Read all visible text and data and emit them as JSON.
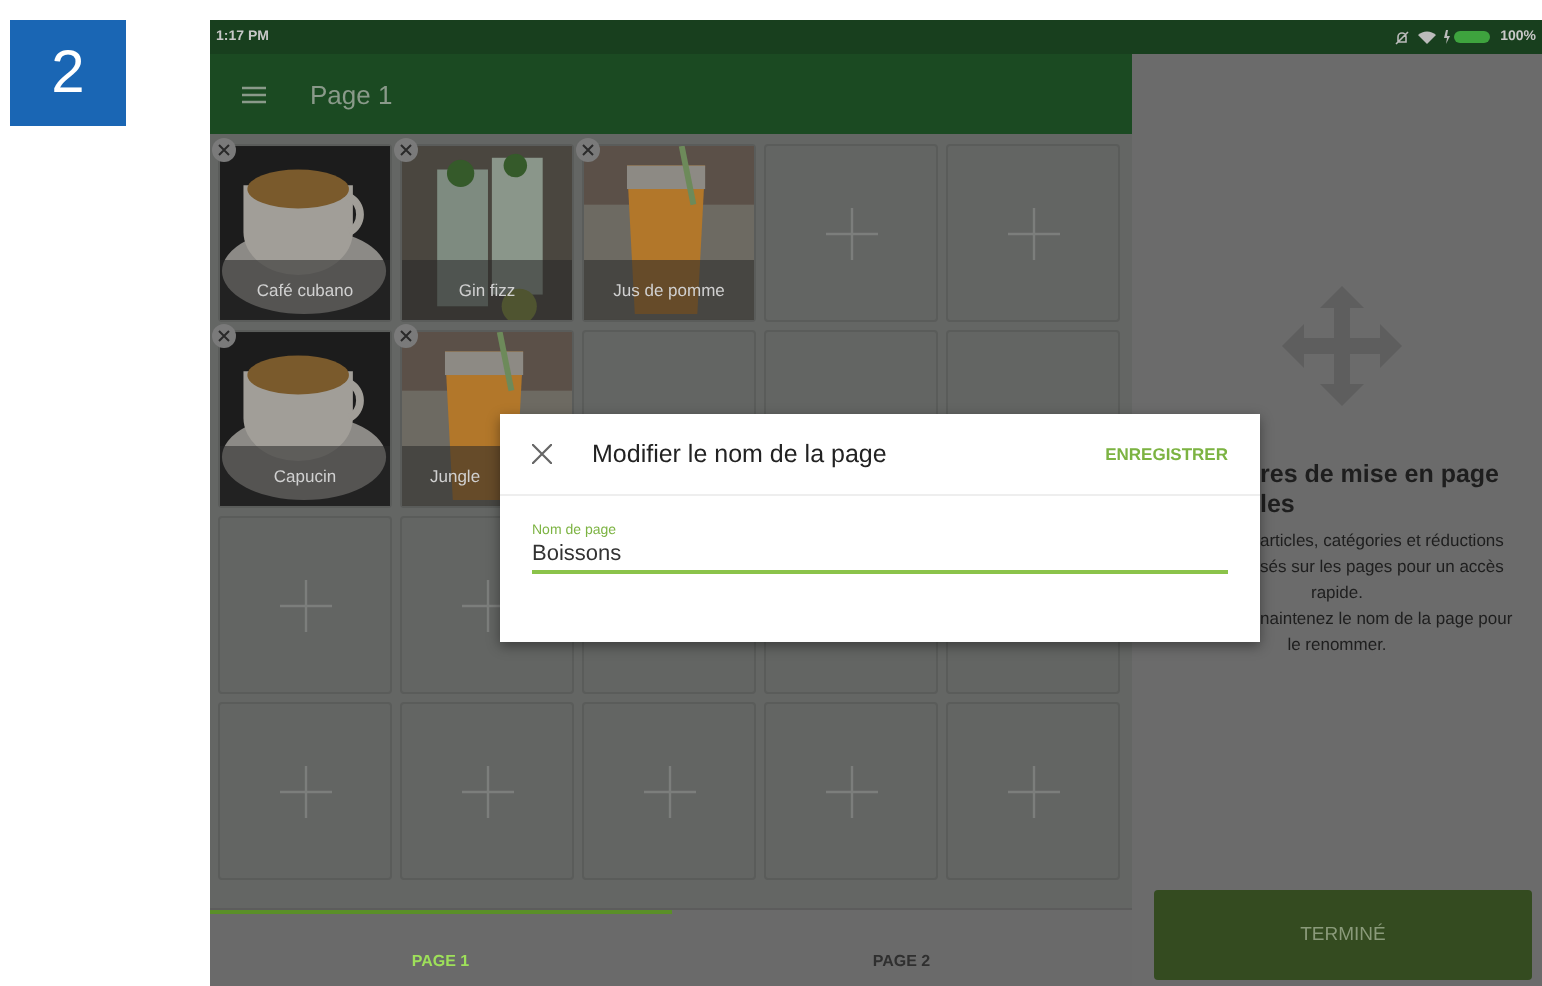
{
  "step_badge": "2",
  "status_bar": {
    "time": "1:17 PM",
    "battery": "100%"
  },
  "header": {
    "title": "Page 1"
  },
  "tiles": [
    {
      "kind": "item",
      "label": "Café cubano",
      "truncated": false
    },
    {
      "kind": "item",
      "label": "Gin fizz",
      "truncated": false
    },
    {
      "kind": "item",
      "label": "Jus de pomme",
      "truncated": false
    },
    {
      "kind": "empty"
    },
    {
      "kind": "empty"
    },
    {
      "kind": "item",
      "label": "Capucin",
      "truncated": false
    },
    {
      "kind": "item",
      "label": "Jungle",
      "truncated": true
    },
    {
      "kind": "covered"
    },
    {
      "kind": "covered"
    },
    {
      "kind": "covered"
    },
    {
      "kind": "empty"
    },
    {
      "kind": "empty"
    },
    {
      "kind": "covered"
    },
    {
      "kind": "covered"
    },
    {
      "kind": "covered"
    },
    {
      "kind": "empty"
    },
    {
      "kind": "empty"
    },
    {
      "kind": "empty"
    },
    {
      "kind": "empty"
    },
    {
      "kind": "empty"
    }
  ],
  "tabs": [
    {
      "label": "PAGE 1",
      "selected": true
    },
    {
      "label": "PAGE 2",
      "selected": false
    }
  ],
  "side_panel": {
    "title_lines": [
      "res de mise en page",
      "les"
    ],
    "body_lines": [
      {
        "kind": "cut",
        "text": "articles, catégories et réductions"
      },
      {
        "kind": "cut",
        "text": "sés sur les pages pour un accès"
      },
      {
        "kind": "full",
        "text": "rapide."
      },
      {
        "kind": "cut",
        "text": "naintenez le nom de la page pour"
      },
      {
        "kind": "full",
        "text": "le renommer."
      }
    ],
    "done_button": "TERMINÉ"
  },
  "dialog": {
    "title": "Modifier le nom de la page",
    "save": "ENREGISTRER",
    "field_label": "Nom de page",
    "field_value": "Boissons"
  }
}
